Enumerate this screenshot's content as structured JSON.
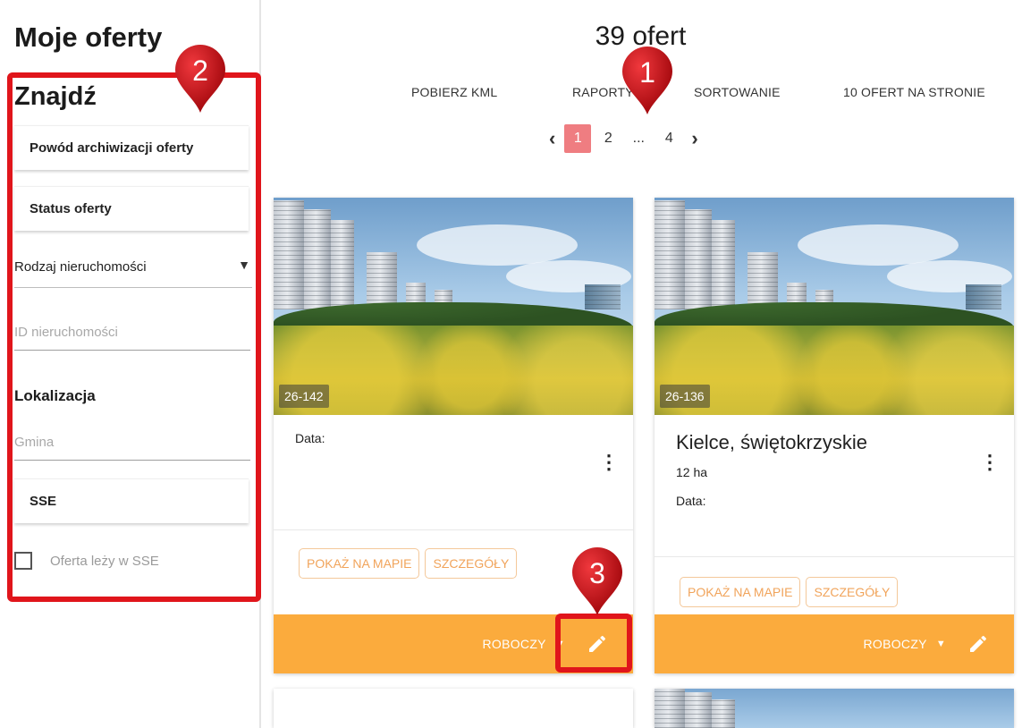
{
  "sidebar": {
    "title": "Moje oferty",
    "find_heading": "Znajdź",
    "archive_reason": "Powód archiwizacji oferty",
    "offer_status": "Status oferty",
    "property_type": "Rodzaj nieruchomości",
    "property_id_placeholder": "ID nieruchomości",
    "location_heading": "Lokalizacja",
    "commune_placeholder": "Gmina",
    "sse": "SSE",
    "sse_checkbox_label": "Oferta leży w SSE"
  },
  "header": {
    "results": "39 ofert",
    "toolbar": [
      "POBIERZ KML",
      "RAPORTY",
      "SORTOWANIE",
      "10 OFERT NA STRONIE"
    ]
  },
  "pagination": {
    "pages": [
      "1",
      "2",
      "...",
      "4"
    ],
    "current": "1"
  },
  "cards": [
    {
      "id_badge": "26-142",
      "title": "",
      "area": "",
      "date_label": "Data:",
      "show_on_map": "POKAŻ NA MAPIE",
      "details": "SZCZEGÓŁY",
      "status": "ROBOCZY"
    },
    {
      "id_badge": "26-136",
      "title": "Kielce, świętokrzyskie",
      "area": "12 ha",
      "date_label": "Data:",
      "show_on_map": "POKAŻ NA MAPIE",
      "details": "SZCZEGÓŁY",
      "status": "ROBOCZY"
    }
  ],
  "annotations": [
    "1",
    "2",
    "3"
  ],
  "colors": {
    "accent_orange": "#fbab3d",
    "active_page": "#ef7d81",
    "highlight_red": "#e0151b",
    "outline_button_text": "#f1a45b"
  },
  "icons": [
    "chevron-left-icon",
    "chevron-right-icon",
    "kebab-menu-icon",
    "caret-down-icon",
    "pencil-icon",
    "dropdown-arrow-icon"
  ]
}
